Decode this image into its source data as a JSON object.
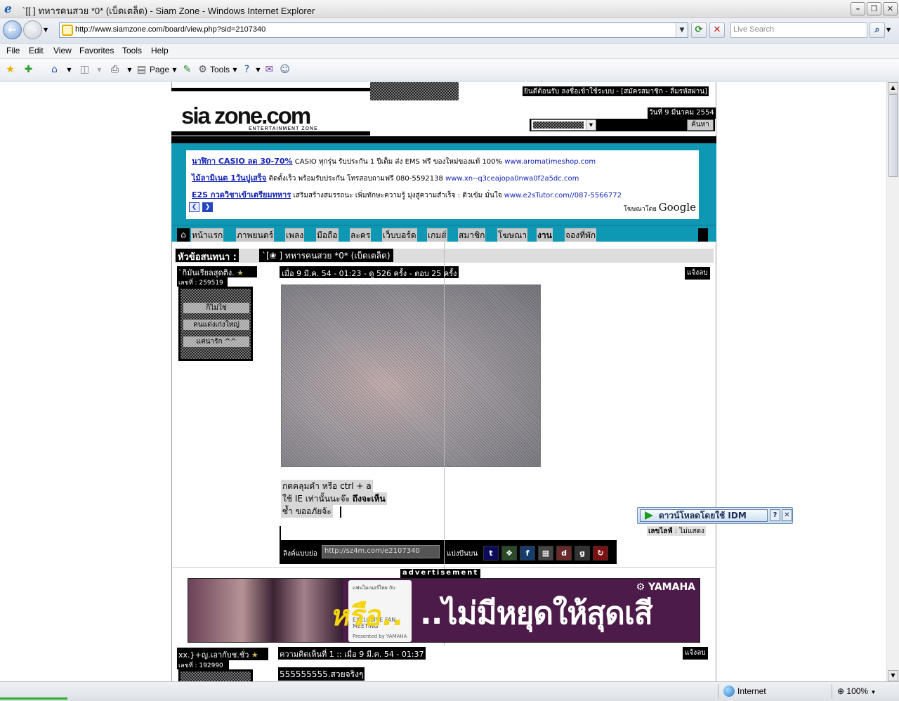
{
  "window": {
    "title": "`[[ ] ทหารคนสวย *0* (เบ็ดเตล็ด) - Siam Zone - Windows Internet Explorer"
  },
  "addressbar": {
    "url": "http://www.siamzone.com/board/view.php?sid=2107340",
    "search_placeholder": "Live Search"
  },
  "menu": [
    "File",
    "Edit",
    "View",
    "Favorites",
    "Tools",
    "Help"
  ],
  "commandbar": {
    "page_label": "Page",
    "tools_label": "Tools"
  },
  "header": {
    "logo": "sia zone.com",
    "logo_sub": "ENTERTAINMENT ZONE",
    "welcome": "ยินดีต้อนรับ ลงชื่อเข้าใช้ระบบ - [สมัครสมาชิก - ลืมรหัสผ่าน]",
    "date": "วันที่ 9 มีนาคม 2554",
    "search_button": "ค้นหา"
  },
  "google_ads": [
    {
      "headline": "นาฬิกา CASIO ลด 30-70%",
      "text": "CASIO ทุกรุ่น รับประกัน 1 ปีเต็ม ส่ง EMS ฟรี ของใหม่ของแท้ 100%",
      "url": "www.aromatimeshop.com"
    },
    {
      "headline": "ไม้ลามิเนต 1วันปูเสร็จ",
      "text": "ติดตั้งเร็ว พร้อมรับประกัน โทรสอบถามฟรี 080-5592138",
      "url": "www.xn--q3ceajopa0nwa0f2a5dc.com"
    },
    {
      "headline": "E2S กวดวิชาเข้าเตรียมทหาร",
      "text": "เสริมสร้างสมรรถนะ เพิ่มทักษะความรู้ มุ่งสู่ความสำเร็จ : ติวเข้ม มั่นใจ",
      "url": "www.e2sTutor.com//087-5566772"
    }
  ],
  "ads_by": "โฆษณาโดย",
  "ads_brand": "Google",
  "nav": [
    "หน้าแรก",
    "ภาพยนตร์",
    "เพลง",
    "มือถือ",
    "ละคร",
    "เว็บบอร์ด",
    "เกมส์",
    "สมาชิก",
    "โฆษณา",
    "งาน",
    "จองที่พัก"
  ],
  "topic": {
    "label": "หัวข้อสนทนา",
    "sep": ":",
    "title": "`[❀ ] ทหารคนสวย *0* (เบ็ดเตล็ด)"
  },
  "post1": {
    "user": "`กิมันเรียลสุดติง.",
    "user_no": "เลขที่ : 259519",
    "sig_lines": [
      "ก็ไม่ใช่",
      "คนแต่งเก่งใหญ่",
      "แค่น่ารัก ^^"
    ],
    "meta": "เมื่อ 9 มี.ค. 54 - 01:23 - ดู 526 ครั้ง - ตอบ 25 ครั้ง",
    "report": "แจ้งลบ",
    "text_lines": [
      "กดคลุมดำ หรือ ctrl + a",
      "ใช้ IE เท่านั้นนะจ๊ะ ",
      "ซ้ำ ขออภัยจ้ะ"
    ],
    "text_bold": "ถึงจะเห็น",
    "lifestyle_label": "เลขไลฟ์",
    "lifestyle_value": " : ไม่แสดง"
  },
  "share": {
    "label": "ลิงค์แบบย่อ",
    "link": "http://sz4m.com/e2107340",
    "share_label": "แบ่งปันบน"
  },
  "ad_label": "advertisement",
  "banner": {
    "card_top": "แฟนไมเนอร์ไทย กับ",
    "card_mid": "EXCLUSIVE FAN MEETING",
    "card_bottom": "Presented by YAMAHA",
    "yellow_text": "หรือ..",
    "slogan": "..ไม่มีหยุดให้สุดเสี",
    "brand": "YAMAHA"
  },
  "post2": {
    "user": "xx.}+ญ.เอากับช.ชั่ว",
    "user_no": "เลขที่ : 192990",
    "meta": "ความคิดเห็นที่ 1 :: เมื่อ 9 มี.ค. 54 - 01:37",
    "report": "แจ้งลบ",
    "comment": "555555555.สวยจริงๆ"
  },
  "idm": {
    "label": "ดาวน์โหลดโดยใช้ IDM"
  },
  "statusbar": {
    "zone": "Internet",
    "zoom": "100%"
  }
}
